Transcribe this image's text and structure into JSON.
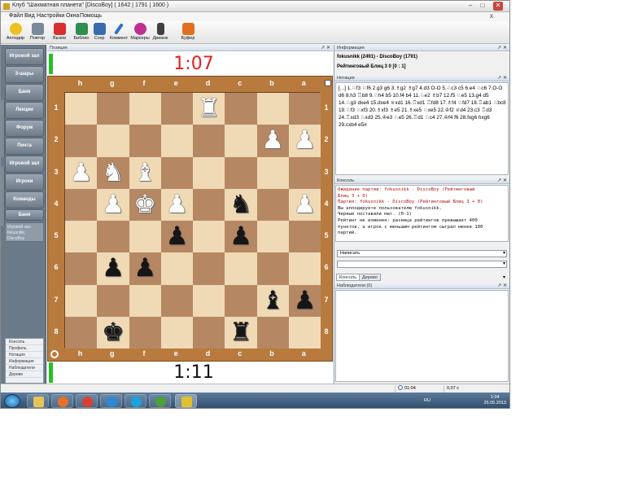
{
  "window": {
    "title": "Клуб \"Шахматная планета\" [DiscoBoy] ( 1642 | 1791 | 1600 )",
    "minimize": "–",
    "maximize": "□",
    "close": "✕"
  },
  "menu": {
    "items": [
      "Файл",
      "Вид",
      "Настройки",
      "Окна",
      "Помощь"
    ],
    "close": "x"
  },
  "toolbar": {
    "buttons": [
      {
        "label": "Аплодир",
        "color": "#f0c020"
      },
      {
        "label": "Повтор",
        "color": "#7a8a9a"
      },
      {
        "label": "Вызов",
        "color": "#d83030"
      },
      {
        "label": "Библио",
        "color": "#2f8f4f"
      },
      {
        "label": "Сохр",
        "color": "#3a6ab0"
      },
      {
        "label": "Коммент",
        "color": "#3070c0"
      },
      {
        "label": "Маркеры",
        "color": "#c03090"
      },
      {
        "label": "Движок",
        "color": "#404040"
      },
      {
        "label": "Буфер",
        "color": "#e07020"
      }
    ]
  },
  "sidebar": {
    "buttons": [
      "Игровой зал",
      "3-шары",
      "Баня",
      "Лекции",
      "Форум",
      "Почта",
      "Игровой зал",
      "Игроки",
      "Команды",
      "Баня"
    ],
    "thumb_text": "Игровой зал: fokusnikk, DiscoBoy",
    "bottom_items": [
      "Консоль",
      "Профиль",
      "Нотация",
      "Информация",
      "Наблюдатели",
      "Дерево"
    ]
  },
  "position_panel": {
    "header": "Позиция",
    "close": "↗ ✕",
    "top_clock": "1:07",
    "bottom_clock": "1:11",
    "files": [
      "h",
      "g",
      "f",
      "e",
      "d",
      "c",
      "b",
      "a"
    ],
    "ranks": [
      "1",
      "2",
      "3",
      "4",
      "5",
      "6",
      "7",
      "8"
    ],
    "pieces": [
      {
        "sq": "d1",
        "glyph": "♜",
        "color": "w"
      },
      {
        "sq": "b2",
        "glyph": "♟",
        "color": "w"
      },
      {
        "sq": "a2",
        "glyph": "♟",
        "color": "w"
      },
      {
        "sq": "h3",
        "glyph": "♟",
        "color": "w"
      },
      {
        "sq": "g3",
        "glyph": "♞",
        "color": "w"
      },
      {
        "sq": "f3",
        "glyph": "♝",
        "color": "w"
      },
      {
        "sq": "g4",
        "glyph": "♟",
        "color": "w"
      },
      {
        "sq": "f4",
        "glyph": "♚",
        "color": "w"
      },
      {
        "sq": "e4",
        "glyph": "♟",
        "color": "w"
      },
      {
        "sq": "c4",
        "glyph": "♞",
        "color": "b"
      },
      {
        "sq": "a4",
        "glyph": "♟",
        "color": "w"
      },
      {
        "sq": "e5",
        "glyph": "♟",
        "color": "b"
      },
      {
        "sq": "c5",
        "glyph": "♟",
        "color": "b"
      },
      {
        "sq": "g6",
        "glyph": "♟",
        "color": "b"
      },
      {
        "sq": "f6",
        "glyph": "♟",
        "color": "b"
      },
      {
        "sq": "b7",
        "glyph": "♝",
        "color": "b"
      },
      {
        "sq": "a7",
        "glyph": "♟",
        "color": "b"
      },
      {
        "sq": "g8",
        "glyph": "♚",
        "color": "b"
      },
      {
        "sq": "c8",
        "glyph": "♜",
        "color": "b"
      }
    ]
  },
  "info_panel": {
    "header": "Информация",
    "close": "↗ ✕",
    "players": "fokusnikk (2491) - DiscoBoy (1791)",
    "game": "Рейтинговый Блиц 3 0 [0 : 1]"
  },
  "notation_panel": {
    "header": "Нотация",
    "close": "↗ ✕",
    "moves": "[...] 1.♘f3 ♘f6 2.g3 g6 3.♗g2 ♗g7 4.d3 O-O 5.♘c3 c5 6.e4 ♘c6 7.O-O d6 8.h3 ♖b8 9.♘h4 b5 10.f4 b4 11.♘e2 ♗b7 12.f5 ♘e5 13.g4 d5 14.♘g3 dxe4 15.dxe4 ♕xd1 16.♖xd1 ♖fd8 17.♗f4 ♘fd7 18.♖ab1 ♘bc8 19.♘f3 ♘xf3 20.♗xf3 ♗e5 21.♗xe5 ♘xe5 22.♔f2 ♕d4 23.c3 ♖d3 24.♖xd3 ♘xd3 25.♔e3 ♘e5 26.♖d1 ♘c4 27.♔f4 f6 28.fxg6 hxg6 29.cxb4 e5#"
  },
  "console_panel": {
    "header": "Консоль",
    "close": "↗ ✕",
    "lines": [
      {
        "text": "Ожидание партии: fokusnikk - DiscoBoy (Рейтинговый",
        "color": "#b01010"
      },
      {
        "text": "Блиц 3 + 0)",
        "color": "#b01010"
      },
      {
        "text": "Партия: fokusnikk - DiscoBoy (Рейтинговый Блиц 3 + 0)",
        "color": "#b01010"
      },
      {
        "text": "Вы аплодируете пользователю fokusnikk.",
        "color": "#111111"
      },
      {
        "text": "Черные поставили мат. (0-1)",
        "color": "#111111"
      },
      {
        "text": "Рейтинг не изменен: разница рейтингов превышает 400",
        "color": "#111111"
      },
      {
        "text": "пунктов, а игрок с меньшим рейтингом сыграл менее 100",
        "color": "#111111"
      },
      {
        "text": "партий.",
        "color": "#111111"
      }
    ],
    "input_mode": "Написать",
    "input_value": ""
  },
  "tabs": [
    "Консоль",
    "Дерево"
  ],
  "watchers_panel": {
    "header": "Наблюдатели (0)",
    "close": "↗ ✕"
  },
  "statusbar": {
    "timer": "01:04",
    "value": "0,07 с"
  },
  "taskbar": {
    "lang": "RU",
    "time": "1:04",
    "date": "25.05.2013",
    "apps": [
      {
        "name": "explorer",
        "color": "#e8c35a"
      },
      {
        "name": "firefox",
        "color": "#e8702a"
      },
      {
        "name": "chrome",
        "color": "#d9402f"
      },
      {
        "name": "ie",
        "color": "#2a8ad8"
      },
      {
        "name": "skype",
        "color": "#1aa3e0"
      },
      {
        "name": "utorrent",
        "color": "#4da03a"
      },
      {
        "name": "chess",
        "color": "#e0c030"
      }
    ]
  }
}
